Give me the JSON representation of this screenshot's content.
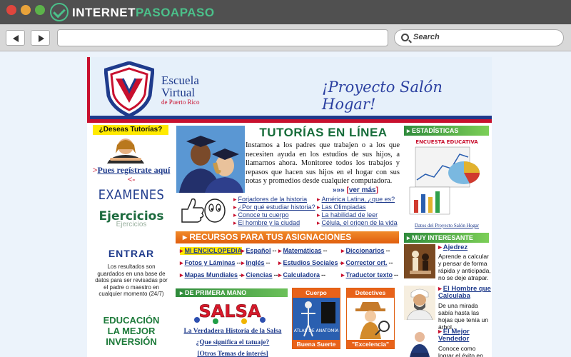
{
  "browser": {
    "brand_prefix": "INTERNET",
    "brand_highlight": "PASOAPASO",
    "search_placeholder": "Search",
    "url": ""
  },
  "colors": {
    "brand_red": "#c8102e",
    "brand_blue": "#1f3b8c",
    "section_orange": "#e8621a",
    "section_green": "#2f8b3c",
    "highlight_yellow": "#ffea00"
  },
  "header": {
    "logo_line1": "Escuela",
    "logo_line2": "Virtual",
    "logo_line3": "de Puerto Rico",
    "tagline": "¡Proyecto Salón Hogar!"
  },
  "left": {
    "tutorias_question": "¿Deseas Tutorías?",
    "register_arrow": ">",
    "register_link": "Pues regístrate aquí",
    "register_trail": "<-",
    "examenes": "EXAMENES",
    "ejercicios": "Ejercicios",
    "entrar": "ENTRAR",
    "entrar_note": "Los resultados son guardados en una base de datos para ser revisadas por el padre o maestro en cualquier momento (24/7)",
    "edu_line1": "EDUCACIÓN",
    "edu_line2": "LA MEJOR",
    "edu_line3": "INVERSIÓN"
  },
  "tutorias": {
    "title": "TUTORÍAS EN LÍNEA",
    "body": "Instamos  a los padres que trabajen o a los que necesiten ayuda en los estudios de sus hijos, a llamarnos ahora.  Monitoree todos los trabajos y repasos que hacen sus hijos en el hogar con sus notas y promedios desde cualquier computadora.",
    "ver_mas_prefix": "»»»",
    "ver_mas": "ver más"
  },
  "links_col1": [
    "Forjadores de la historia",
    "¿Por qué estudiar historia?",
    "Conoce tu cuerpo",
    "El hombre y la ciudad"
  ],
  "links_col2": [
    "América Latina, ¿que es?",
    "Las Olimpiadas",
    "La habilidad de leer",
    "Célula, el origen de la vida"
  ],
  "recursos": {
    "title": "RECURSOS PARA TUS ASIGNACIONES",
    "items": [
      {
        "label": "MI ENCICLOPEDIA",
        "suffix": ""
      },
      {
        "label": "Español",
        "suffix": "--"
      },
      {
        "label": "Matemáticas",
        "suffix": "--"
      },
      {
        "label": "Diccionarios",
        "suffix": "--"
      },
      {
        "label": "Fotos y Láminas",
        "suffix": "--"
      },
      {
        "label": "Inglés",
        "suffix": "--"
      },
      {
        "label": "Estudios Sociales",
        "suffix": "--"
      },
      {
        "label": "Corrector ort.",
        "suffix": "--"
      },
      {
        "label": "Mapas Mundiales",
        "suffix": "--"
      },
      {
        "label": "Ciencias",
        "suffix": "--"
      },
      {
        "label": "Calculadora",
        "suffix": "--"
      },
      {
        "label": "Traductor texto",
        "suffix": "--"
      }
    ]
  },
  "primera_mano": {
    "title": "DE PRIMERA MANO",
    "banner": "SALSA",
    "links": [
      "La Verdadera Historia de la Salsa",
      "¿Que significa el tatuaje?",
      "[Otros Temas de interés]"
    ]
  },
  "categories": [
    {
      "title": "Cuerpo Humano",
      "inner": "ATLAS DE ANATOMÍA",
      "footer": "Buena Suerte"
    },
    {
      "title": "Detectives",
      "inner": "",
      "footer": "\"Excelencia\""
    }
  ],
  "estadisticas": {
    "title": "ESTADÍSTICAS",
    "chart_label": "ENCUESTA EDUCATIVA",
    "caption": "Datos del Proyecto Salón Hogar"
  },
  "muy_interesante": {
    "title": "MUY INTERESANTE",
    "items": [
      {
        "title": "Ajedrez",
        "desc": "Aprende a calcular y pensar de forma rápida y anticipada, no se deje atrapar."
      },
      {
        "title": "El Hombre que Calculaba",
        "desc": "De una mirada sabía hasta las hojas que tenía un árbol..."
      },
      {
        "title": "El Mejor Vendedor",
        "desc": "Conoce como lograr el éxito en"
      }
    ]
  }
}
